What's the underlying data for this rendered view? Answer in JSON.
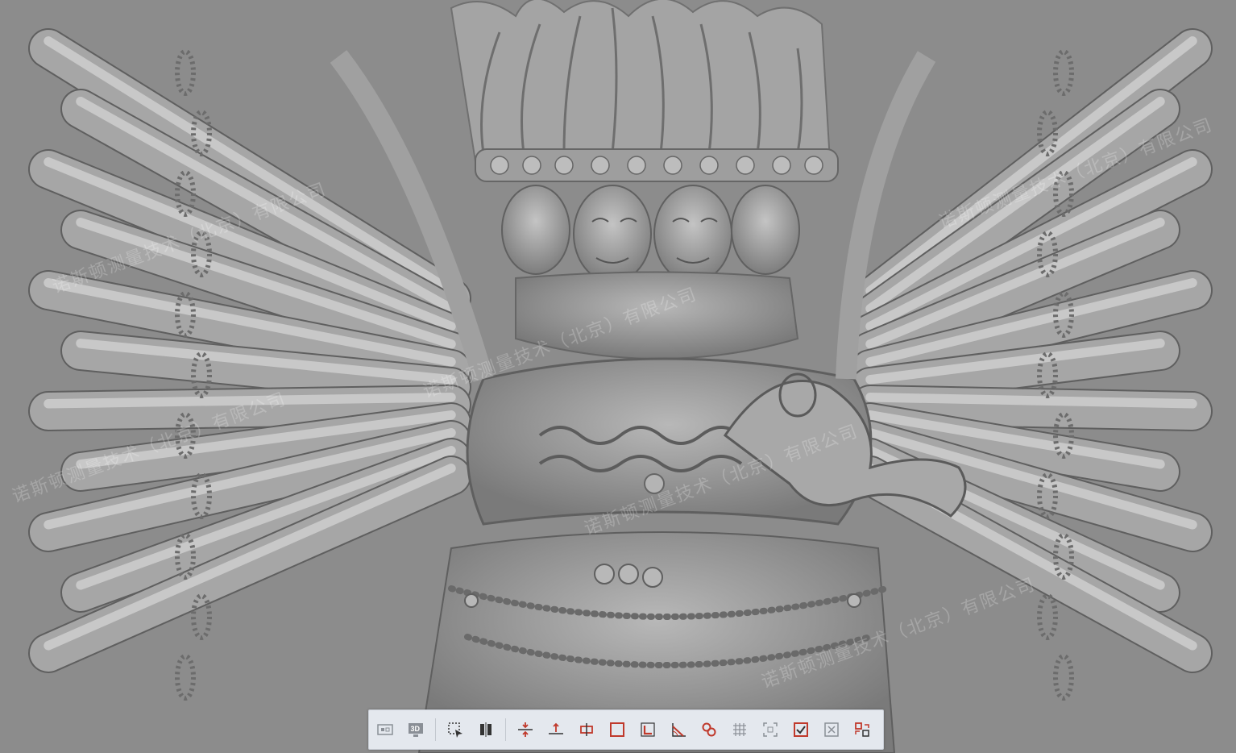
{
  "viewport": {
    "watermarks": [
      "诺斯顿测量技术（北京）有限公司",
      "诺斯顿测量技术（北京）有限公司",
      "诺斯顿测量技术（北京）有限公司",
      "诺斯顿测量技术（北京）有限公司",
      "诺斯顿测量技术（北京）有限公司",
      "诺斯顿测量技术（北京）有限公司"
    ]
  },
  "toolbar": {
    "buttons": [
      {
        "name": "view-2d-icon"
      },
      {
        "name": "view-3d-icon",
        "label": "3D"
      },
      {
        "name": "select-region-icon"
      },
      {
        "name": "split-view-icon"
      },
      {
        "name": "align-center-icon"
      },
      {
        "name": "align-bottom-icon"
      },
      {
        "name": "align-middle-icon"
      },
      {
        "name": "rectangle-icon"
      },
      {
        "name": "corner-marker-icon"
      },
      {
        "name": "angle-measure-icon"
      },
      {
        "name": "link-icon"
      },
      {
        "name": "grid-icon"
      },
      {
        "name": "fit-frame-icon"
      },
      {
        "name": "check-box-icon"
      },
      {
        "name": "delete-box-icon"
      },
      {
        "name": "transform-icon"
      }
    ],
    "accent_color": "#c0392b",
    "muted_color": "#8a8f96"
  }
}
